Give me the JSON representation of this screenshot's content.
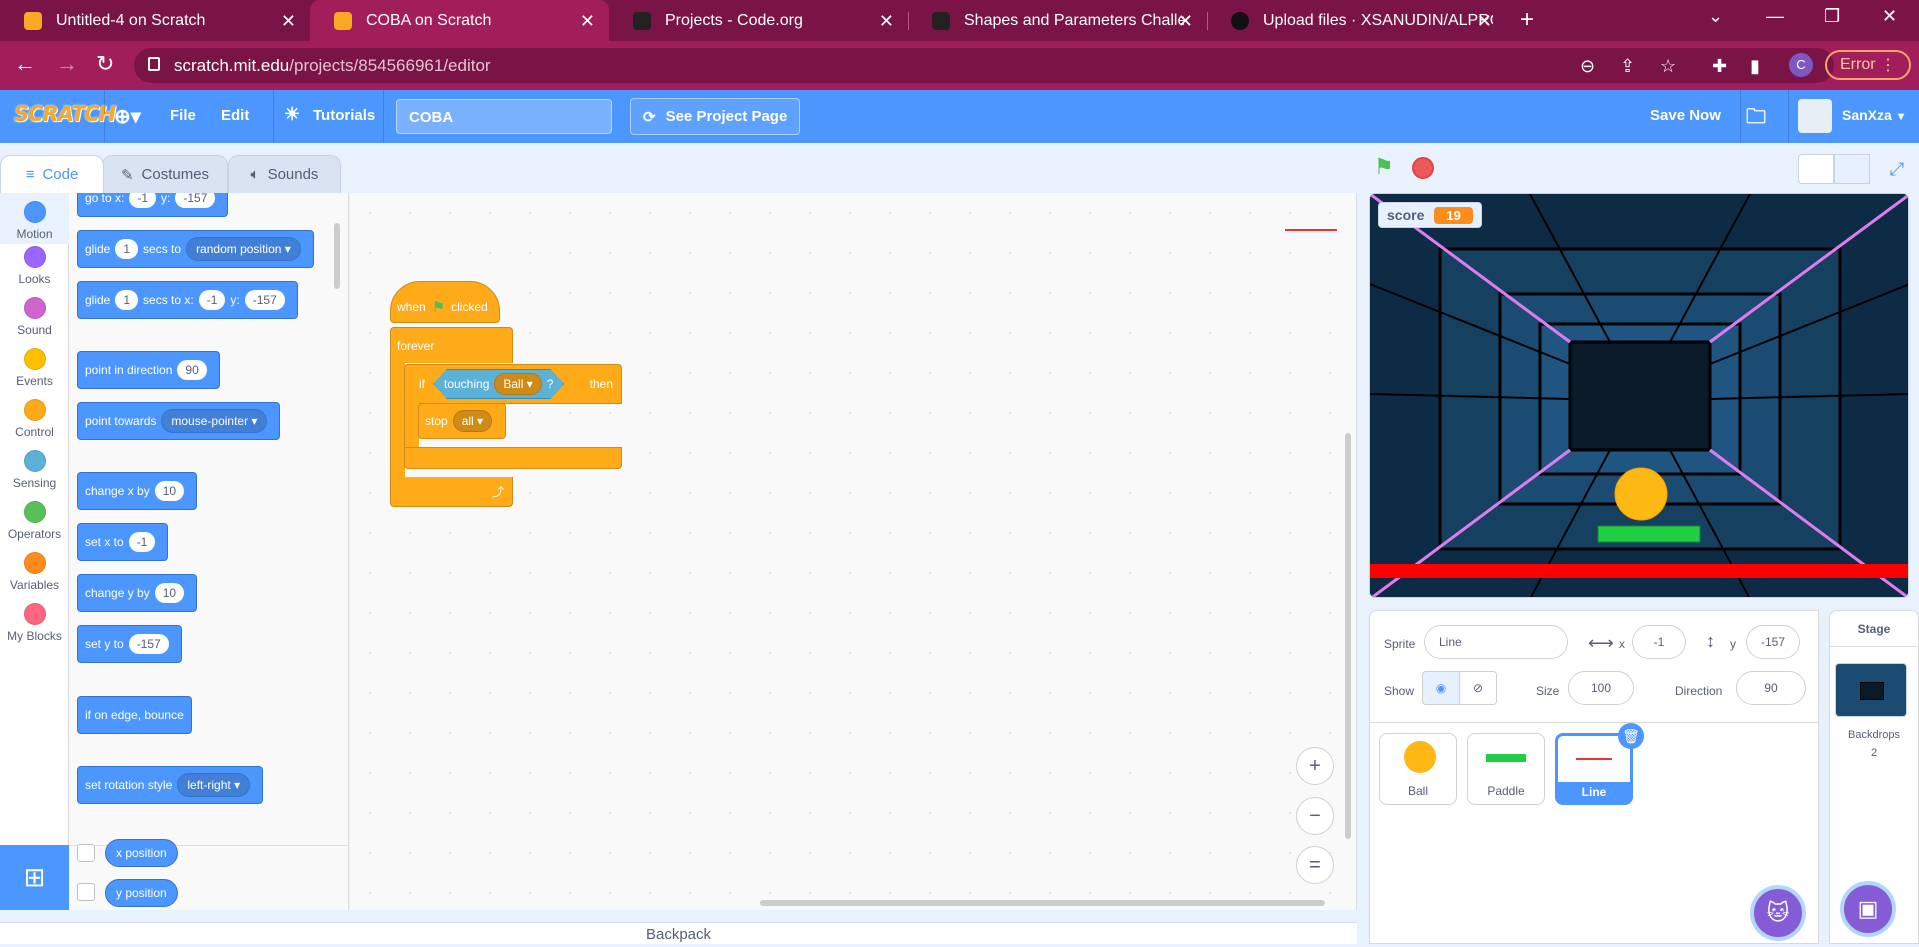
{
  "browser": {
    "tabs": [
      {
        "title": "Untitled-4 on Scratch",
        "fav": "#f9a825"
      },
      {
        "title": "COBA on Scratch",
        "fav": "#f9a825"
      },
      {
        "title": "Projects - Code.org",
        "fav": "#222222"
      },
      {
        "title": "Shapes and Parameters Challeng",
        "fav": "#222222"
      },
      {
        "title": "Upload files · XSANUDIN/ALPRO",
        "fav": "#111111"
      }
    ],
    "url_host": "scratch.mit.edu",
    "url_path": "/projects/854566961/editor",
    "profile_letter": "C",
    "error_label": "Error"
  },
  "menubar": {
    "logo": "SCRATCH",
    "file": "File",
    "edit": "Edit",
    "tutorials": "Tutorials",
    "project_title": "COBA",
    "see_project": "See Project Page",
    "save_now": "Save Now",
    "username": "SanXza"
  },
  "editor_tabs": {
    "code": "Code",
    "costumes": "Costumes",
    "sounds": "Sounds"
  },
  "categories": [
    {
      "label": "Motion",
      "color": "#4c97ff"
    },
    {
      "label": "Looks",
      "color": "#9966ff"
    },
    {
      "label": "Sound",
      "color": "#cf63cf"
    },
    {
      "label": "Events",
      "color": "#ffbf00"
    },
    {
      "label": "Control",
      "color": "#ffab19"
    },
    {
      "label": "Sensing",
      "color": "#5cb1d6"
    },
    {
      "label": "Operators",
      "color": "#59c059"
    },
    {
      "label": "Variables",
      "color": "#ff8c1a"
    },
    {
      "label": "My Blocks",
      "color": "#ff6680"
    }
  ],
  "palette": {
    "goto": {
      "t1": "go to x:",
      "x": "-1",
      "t2": "y:",
      "y": "-157"
    },
    "glide_random": {
      "t1": "glide",
      "secs": "1",
      "t2": "secs to",
      "target": "random position"
    },
    "glide_xy": {
      "t1": "glide",
      "secs": "1",
      "t2": "secs to x:",
      "x": "-1",
      "t3": "y:",
      "y": "-157"
    },
    "point_dir": {
      "t1": "point in direction",
      "v": "90"
    },
    "point_towards": {
      "t1": "point towards",
      "target": "mouse-pointer"
    },
    "change_x": {
      "t1": "change x by",
      "v": "10"
    },
    "set_x": {
      "t1": "set x to",
      "v": "-1"
    },
    "change_y": {
      "t1": "change y by",
      "v": "10"
    },
    "set_y": {
      "t1": "set y to",
      "v": "-157"
    },
    "bounce": {
      "t1": "if on edge, bounce"
    },
    "rotation": {
      "t1": "set rotation style",
      "style": "left-right"
    },
    "x_position": "x position",
    "y_position": "y position"
  },
  "script": {
    "when": "when",
    "clicked": "clicked",
    "forever": "forever",
    "if": "if",
    "touching": "touching",
    "touch_target": "Ball",
    "q": "?",
    "then": "then",
    "stop": "stop",
    "stop_option": "all"
  },
  "zoom": {
    "in": "+",
    "out": "−",
    "reset": "="
  },
  "backpack": "Backpack",
  "stage": {
    "monitor_label": "score",
    "monitor_value": "19"
  },
  "sprite_info": {
    "sprite_label": "Sprite",
    "sprite_name": "Line",
    "x_label": "x",
    "x_value": "-1",
    "y_label": "y",
    "y_value": "-157",
    "show_label": "Show",
    "size_label": "Size",
    "size_value": "100",
    "direction_label": "Direction",
    "direction_value": "90"
  },
  "sprites": [
    {
      "name": "Ball"
    },
    {
      "name": "Paddle"
    },
    {
      "name": "Line"
    }
  ],
  "stage_panel": {
    "title": "Stage",
    "backdrops_label": "Backdrops",
    "backdrops_count": "2"
  }
}
